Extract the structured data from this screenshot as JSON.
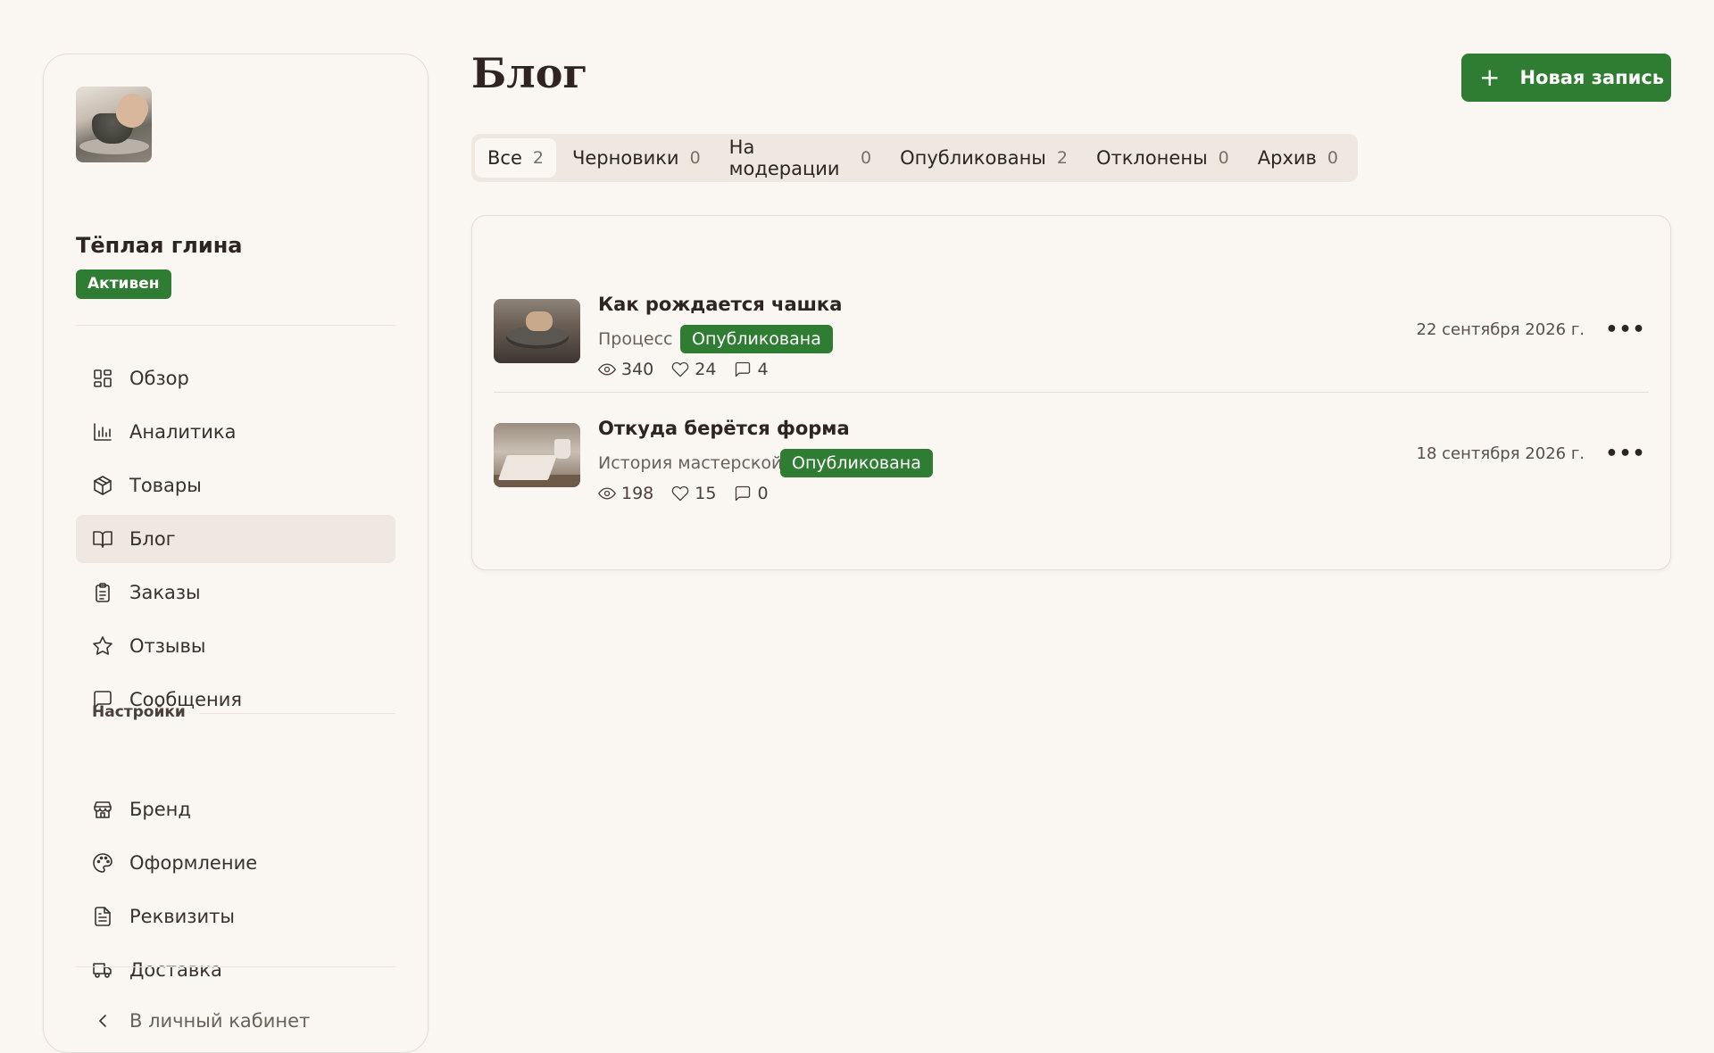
{
  "sidebar": {
    "shop_name": "Тёплая глина",
    "status_badge": "Активен",
    "nav": [
      {
        "label": "Обзор",
        "icon": "dashboard-icon"
      },
      {
        "label": "Аналитика",
        "icon": "bar-chart-icon"
      },
      {
        "label": "Товары",
        "icon": "package-icon"
      },
      {
        "label": "Блог",
        "icon": "book-open-icon",
        "active": true
      },
      {
        "label": "Заказы",
        "icon": "clipboard-icon"
      },
      {
        "label": "Отзывы",
        "icon": "star-icon"
      },
      {
        "label": "Сообщения",
        "icon": "message-icon"
      }
    ],
    "settings_label": "Настройки",
    "settings_nav": [
      {
        "label": "Бренд",
        "icon": "store-icon"
      },
      {
        "label": "Оформление",
        "icon": "palette-icon"
      },
      {
        "label": "Реквизиты",
        "icon": "document-icon"
      },
      {
        "label": "Доставка",
        "icon": "truck-icon"
      }
    ],
    "back_link": "В личный кабинет"
  },
  "header": {
    "title": "Блог",
    "new_post_button": "Новая запись",
    "new_post_icon": "plus-icon"
  },
  "tabs": [
    {
      "label": "Все",
      "count": "2",
      "active": true
    },
    {
      "label": "Черновики",
      "count": "0"
    },
    {
      "label": "На модерации",
      "count": "0"
    },
    {
      "label": "Опубликованы",
      "count": "2"
    },
    {
      "label": "Отклонены",
      "count": "0"
    },
    {
      "label": "Архив",
      "count": "0"
    }
  ],
  "posts": [
    {
      "title": "Как рождается чашка",
      "category": "Процесс",
      "status": "Опубликована",
      "views": "340",
      "likes": "24",
      "comments": "4",
      "date": "22 сентября 2026 г."
    },
    {
      "title": "Откуда берётся форма",
      "category": "История мастерской",
      "status": "Опубликована",
      "views": "198",
      "likes": "15",
      "comments": "0",
      "date": "18 сентября 2026 г."
    }
  ],
  "colors": {
    "accent": "#2e7d32",
    "background": "#faf6f2",
    "active_nav": "#efe8e0",
    "text": "#2e2522"
  }
}
